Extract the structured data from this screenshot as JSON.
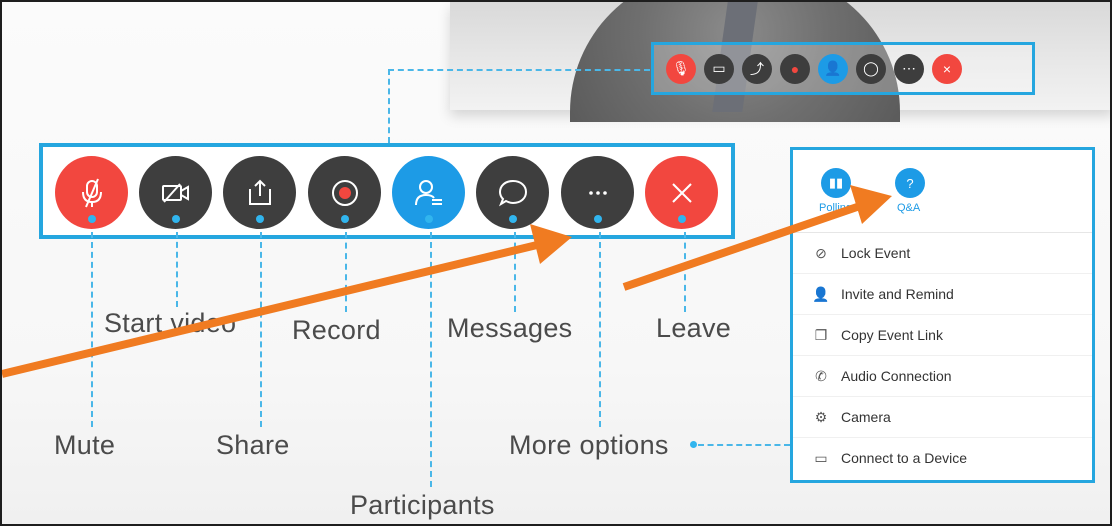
{
  "toolbar": {
    "buttons": [
      {
        "name": "mute",
        "icon": "mic-off-icon",
        "color": "#f2473f"
      },
      {
        "name": "start-video",
        "icon": "video-off-icon",
        "color": "#3e3e3e"
      },
      {
        "name": "share",
        "icon": "share-icon",
        "color": "#3e3e3e"
      },
      {
        "name": "record",
        "icon": "record-icon",
        "color": "#3e3e3e"
      },
      {
        "name": "participants",
        "icon": "participants-icon",
        "color": "#1d9be6"
      },
      {
        "name": "messages",
        "icon": "chat-icon",
        "color": "#3e3e3e"
      },
      {
        "name": "more-options",
        "icon": "more-icon",
        "color": "#3e3e3e"
      },
      {
        "name": "leave",
        "icon": "close-icon",
        "color": "#f2473f"
      }
    ]
  },
  "labels": {
    "start_video": "Start video",
    "record": "Record",
    "messages": "Messages",
    "leave": "Leave",
    "mute": "Mute",
    "share": "Share",
    "more_options": "More options",
    "participants": "Participants"
  },
  "panel": {
    "tiles": [
      {
        "label": "Polling",
        "icon": "polling-icon"
      },
      {
        "label": "Q&A",
        "icon": "qa-icon"
      }
    ],
    "items": [
      {
        "label": "Lock Event",
        "icon": "lock-icon"
      },
      {
        "label": "Invite and Remind",
        "icon": "invite-icon"
      },
      {
        "label": "Copy Event Link",
        "icon": "copy-icon"
      },
      {
        "label": "Audio Connection",
        "icon": "phone-icon"
      },
      {
        "label": "Camera",
        "icon": "gear-icon"
      },
      {
        "label": "Connect to a Device",
        "icon": "cast-icon"
      }
    ]
  },
  "colors": {
    "accent": "#25a6df",
    "red": "#f2473f",
    "blue": "#1d9be6",
    "dark": "#3e3e3e",
    "arrow": "#f07b21"
  }
}
